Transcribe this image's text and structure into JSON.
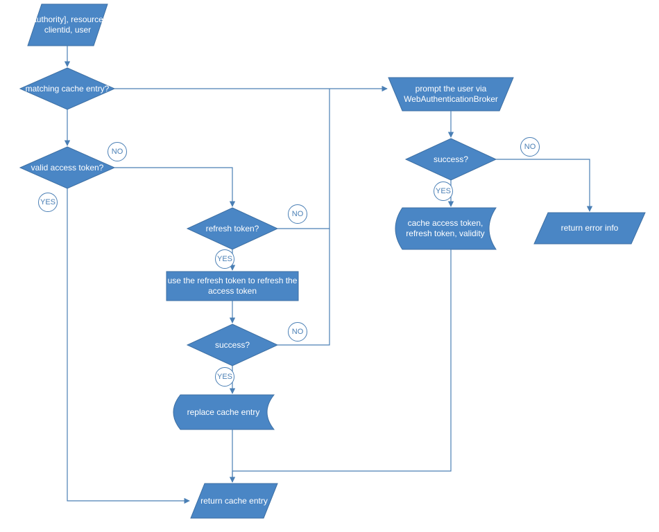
{
  "colors": {
    "fill": "#4a86c5",
    "stroke": "#3d6fa3",
    "line": "#4a7fb5"
  },
  "nodes": {
    "input": "[authority], resource, clientid, user",
    "matchingCache": "matching cache entry?",
    "validAccess": "valid access token?",
    "refreshToken": "refresh token?",
    "useRefresh": "use the refresh token to refresh the access token",
    "refreshSuccess": "success?",
    "replaceCache": "replace cache entry",
    "returnCache": "return cache entry",
    "promptUser": "prompt the user via WebAuthenticationBroker",
    "promptSuccess": "success?",
    "cacheAccess": "cache access token, refresh token, validity",
    "returnError": "return error info"
  },
  "labels": {
    "yes": "YES",
    "no": "NO"
  }
}
